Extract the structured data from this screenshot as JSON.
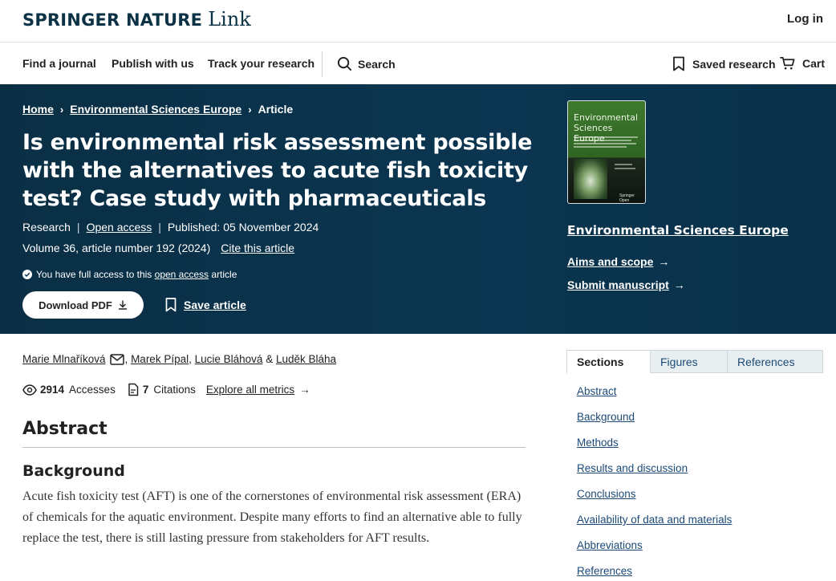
{
  "header": {
    "logo_primary": "SPRINGER NATURE",
    "logo_secondary": "Link",
    "login": "Log in"
  },
  "nav": {
    "items": [
      "Find a journal",
      "Publish with us",
      "Track your research"
    ],
    "search": "Search",
    "saved_research": "Saved research",
    "cart": "Cart"
  },
  "breadcrumb": {
    "home": "Home",
    "journal": "Environmental Sciences Europe",
    "current": "Article"
  },
  "article": {
    "title": "Is environmental risk assessment possible with the alternatives to acute fish toxicity test? Case study with pharmaceuticals",
    "type": "Research",
    "access": "Open access",
    "published": "Published: 05 November 2024",
    "volume": "Volume 36, article number 192 (2024)",
    "cite": "Cite this article",
    "access_note_pre": "You have full access to this",
    "access_note_link": "open access",
    "access_note_post": "article",
    "download_pdf": "Download PDF",
    "save_article": "Save article"
  },
  "journal": {
    "cover_title": "Environmental Sciences Europe",
    "cover_publisher": "Springer Open",
    "name": "Environmental Sciences Europe",
    "aims": "Aims and scope",
    "submit": "Submit manuscript"
  },
  "authors": {
    "a1": "Marie Mlnaříková",
    "a2": "Marek Pípal",
    "a3": "Lucie Bláhová",
    "a4": "Luděk Bláha",
    "sep1": ",",
    "sep2": ",",
    "amp": "&"
  },
  "metrics": {
    "accesses_count": "2914",
    "accesses_label": "Accesses",
    "citations_count": "7",
    "citations_label": "Citations",
    "explore": "Explore all metrics"
  },
  "content": {
    "abstract_heading": "Abstract",
    "background_heading": "Background",
    "background_text": "Acute fish toxicity test (AFT) is one of the cornerstones of environmental risk assessment (ERA) of chemicals for the aquatic environment. Despite many efforts to find an alternative able to fully replace the test, there is still lasting pressure from stakeholders for AFT results."
  },
  "sidebar": {
    "tabs": [
      "Sections",
      "Figures",
      "References"
    ],
    "sections": [
      "Abstract",
      "Background",
      "Methods",
      "Results and discussion",
      "Conclusions",
      "Availability of data and materials",
      "Abbreviations",
      "References"
    ]
  },
  "colors": {
    "hero_background": "#0b3550",
    "link": "#1b4a78",
    "brand": "#0c3246"
  }
}
